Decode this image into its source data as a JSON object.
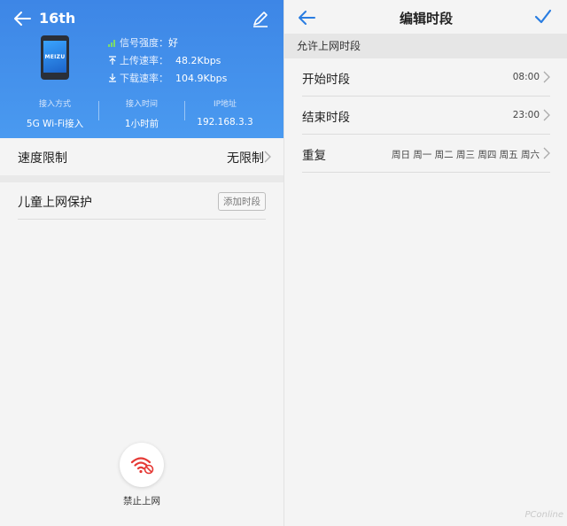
{
  "left": {
    "device_name": "16th",
    "phone_brand": "MEIZU",
    "signal": {
      "label": "信号强度：",
      "value": "好"
    },
    "upload": {
      "label": "上传速率：",
      "value": "48.2Kbps"
    },
    "download": {
      "label": "下载速率：",
      "value": "104.9Kbps"
    },
    "stats": [
      {
        "key": "接入方式",
        "value": "5G Wi-Fi接入"
      },
      {
        "key": "接入时间",
        "value": "1小时前"
      },
      {
        "key": "IP地址",
        "value": "192.168.3.3"
      }
    ],
    "speed_limit": {
      "label": "速度限制",
      "value": "无限制"
    },
    "child_protection": {
      "label": "儿童上网保护",
      "button": "添加时段"
    },
    "block_label": "禁止上网"
  },
  "right": {
    "title": "编辑时段",
    "section": "允许上网时段",
    "rows": [
      {
        "label": "开始时段",
        "value": "08:00"
      },
      {
        "label": "结束时段",
        "value": "23:00"
      },
      {
        "label": "重复",
        "value": "周日 周一 周二 周三 周四 周五 周六"
      }
    ]
  },
  "watermark": "PConline",
  "colors": {
    "header_blue": "#4a9af0",
    "accent_blue": "#2a7de1",
    "block_red": "#e53935"
  }
}
